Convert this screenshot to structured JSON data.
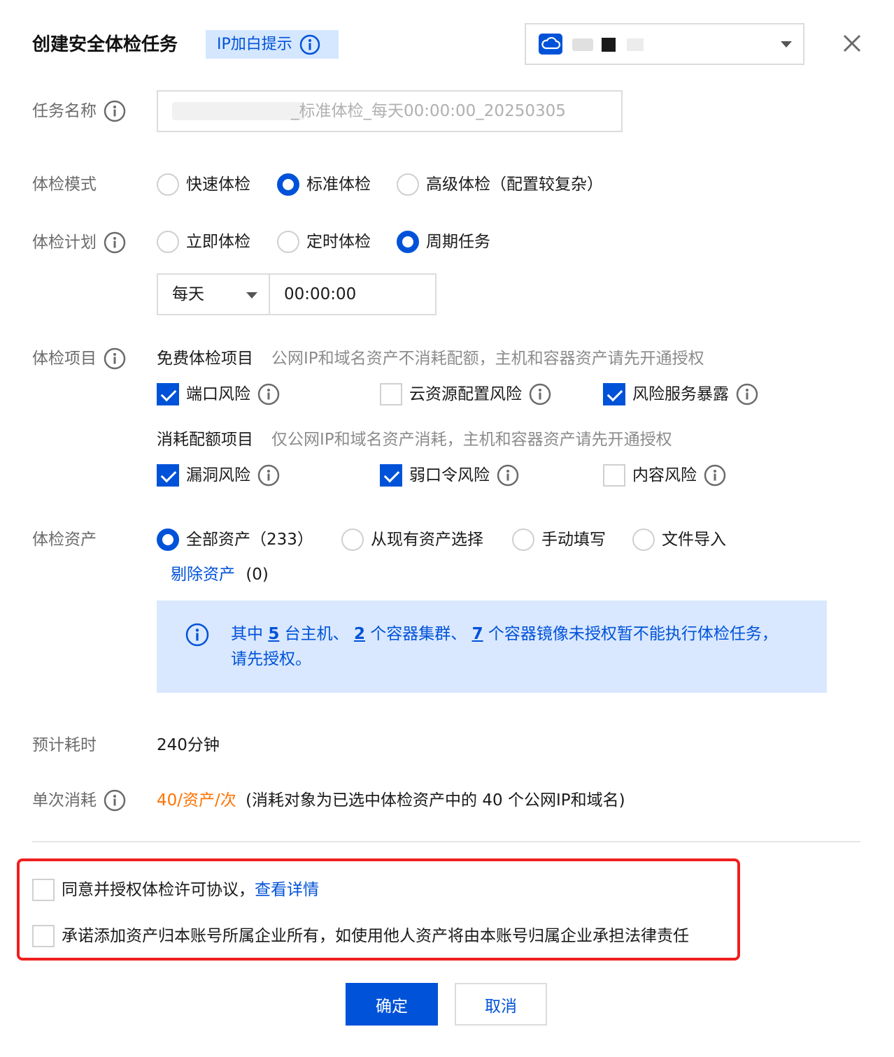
{
  "dialog": {
    "title": "创建安全体检任务",
    "ip_tip": "IP加白提示",
    "close_icon": "close-icon"
  },
  "form": {
    "task_name": {
      "label": "任务名称",
      "value": "_标准体检_每天00:00:00_20250305"
    },
    "mode": {
      "label": "体检模式",
      "options": [
        "快速体检",
        "标准体检",
        "高级体检（配置较复杂）"
      ],
      "selected": "标准体检"
    },
    "plan": {
      "label": "体检计划",
      "options": [
        "立即体检",
        "定时体检",
        "周期任务"
      ],
      "selected": "周期任务",
      "frequency": "每天",
      "time": "00:00:00"
    },
    "items": {
      "label": "体检项目",
      "free_title": "免费体检项目",
      "free_desc": "公网IP和域名资产不消耗配额，主机和容器资产请先开通授权",
      "free_items": [
        {
          "label": "端口风险",
          "checked": true
        },
        {
          "label": "云资源配置风险",
          "checked": false
        },
        {
          "label": "风险服务暴露",
          "checked": true
        }
      ],
      "paid_title": "消耗配额项目",
      "paid_desc": "仅公网IP和域名资产消耗，主机和容器资产请先开通授权",
      "paid_items": [
        {
          "label": "漏洞风险",
          "checked": true
        },
        {
          "label": "弱口令风险",
          "checked": true
        },
        {
          "label": "内容风险",
          "checked": false
        }
      ]
    },
    "assets": {
      "label": "体检资产",
      "options": [
        "全部资产（233）",
        "从现有资产选择",
        "手动填写",
        "文件导入"
      ],
      "selected": "全部资产（233）",
      "exclude_link": "剔除资产",
      "exclude_count": "(0)",
      "alert": {
        "p1": "其中 ",
        "hosts": "5",
        "p2": " 台主机、 ",
        "clusters": "2",
        "p3": " 个容器集群、 ",
        "images": "7",
        "p4": " 个容器镜像未授权暂不能执行体检任务，请先授权。"
      }
    },
    "duration": {
      "label": "预计耗时",
      "value": "240分钟"
    },
    "cost": {
      "label": "单次消耗",
      "value": "40/资产/次",
      "note": "(消耗对象为已选中体检资产中的 40 个公网IP和域名)"
    }
  },
  "agreements": {
    "agree_text": "同意并授权体检许可协议，",
    "agree_link": "查看详情",
    "promise_text": "承诺添加资产归本账号所属企业所有，如使用他人资产将由本账号归属企业承担法律责任"
  },
  "buttons": {
    "ok": "确定",
    "cancel": "取消"
  },
  "colors": {
    "primary": "#0052d9",
    "warning": "#ff7200",
    "highlight_border": "#f01f1f",
    "alert_bg": "#d9e8ff"
  }
}
